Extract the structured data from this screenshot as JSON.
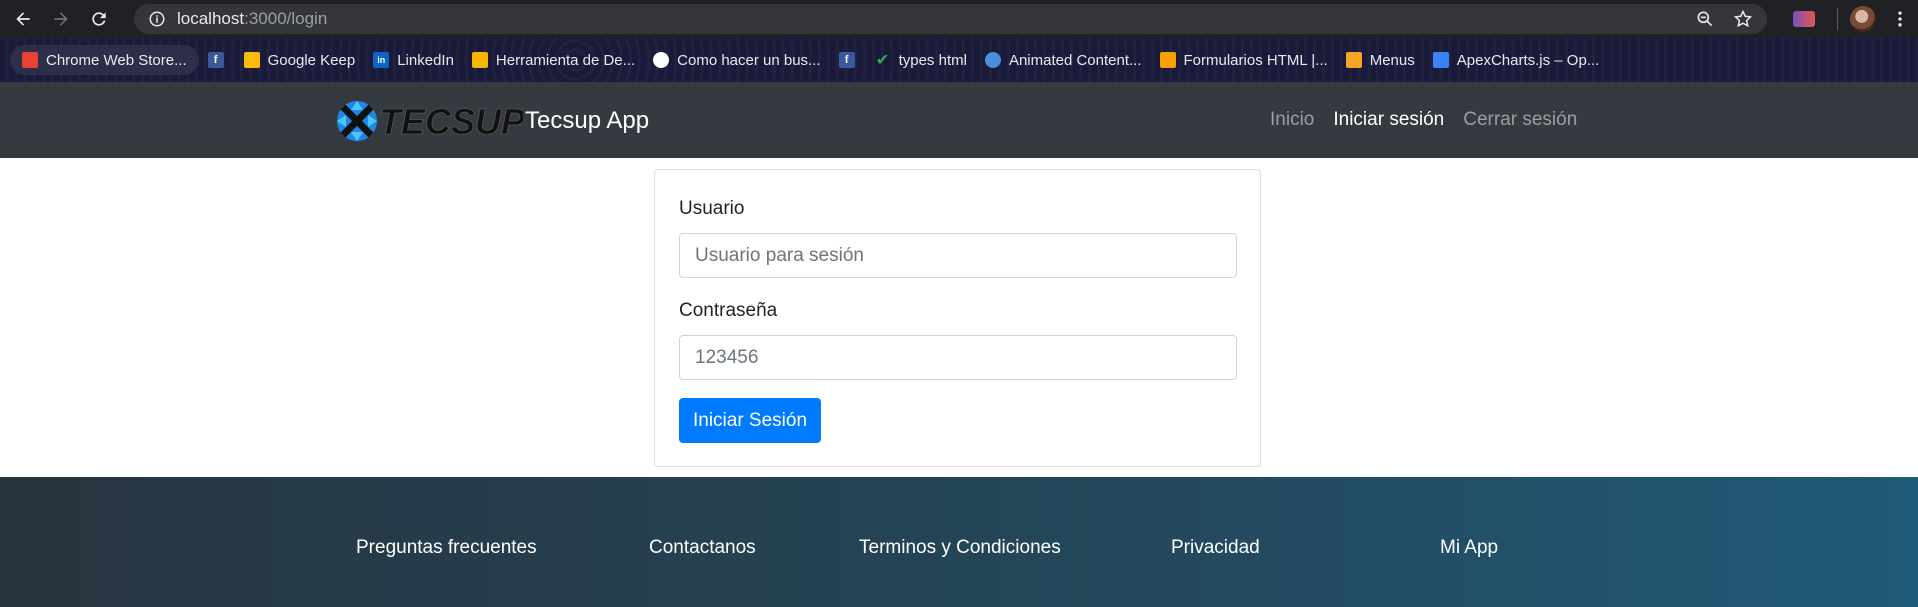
{
  "browser": {
    "url_host": "localhost",
    "url_path": ":3000/login",
    "bookmarks": [
      {
        "label": "Chrome Web Store...",
        "icon": "chrome-web-store-icon",
        "color": "#e94235"
      },
      {
        "label": "",
        "icon": "facebook-icon",
        "color": "#3b5998"
      },
      {
        "label": "Google Keep",
        "icon": "google-keep-icon",
        "color": "#fbbc04"
      },
      {
        "label": "LinkedIn",
        "icon": "linkedin-icon",
        "color": "#0a66c2"
      },
      {
        "label": "Herramienta de De...",
        "icon": "dev-tool-icon",
        "color": "#f4b400"
      },
      {
        "label": "Como hacer un bus...",
        "icon": "globe-icon",
        "color": "#ffffff"
      },
      {
        "label": "",
        "icon": "facebook-icon",
        "color": "#3b5998"
      },
      {
        "label": "types html",
        "icon": "checkmark-icon",
        "color": "#34a853"
      },
      {
        "label": "Animated Content...",
        "icon": "drop-icon",
        "color": "#4a90d9"
      },
      {
        "label": "Formularios HTML |...",
        "icon": "form-icon",
        "color": "#f4a300"
      },
      {
        "label": "Menus",
        "icon": "menu-icon",
        "color": "#f5a623"
      },
      {
        "label": "ApexCharts.js – Op...",
        "icon": "apexcharts-icon",
        "color": "#3b82f6"
      }
    ]
  },
  "navbar": {
    "brand": "Tecsup App",
    "logo_text": "TECSUP",
    "links": [
      "Inicio",
      "Iniciar sesión",
      "Cerrar sesión"
    ]
  },
  "form": {
    "user_label": "Usuario",
    "user_placeholder": "Usuario para sesión",
    "password_label": "Contraseña",
    "password_placeholder": "123456",
    "submit_label": "Iniciar Sesión"
  },
  "footer": {
    "links": [
      "Preguntas frecuentes",
      "Contactanos",
      "Terminos y Condiciones",
      "Privacidad",
      "Mi App"
    ]
  }
}
